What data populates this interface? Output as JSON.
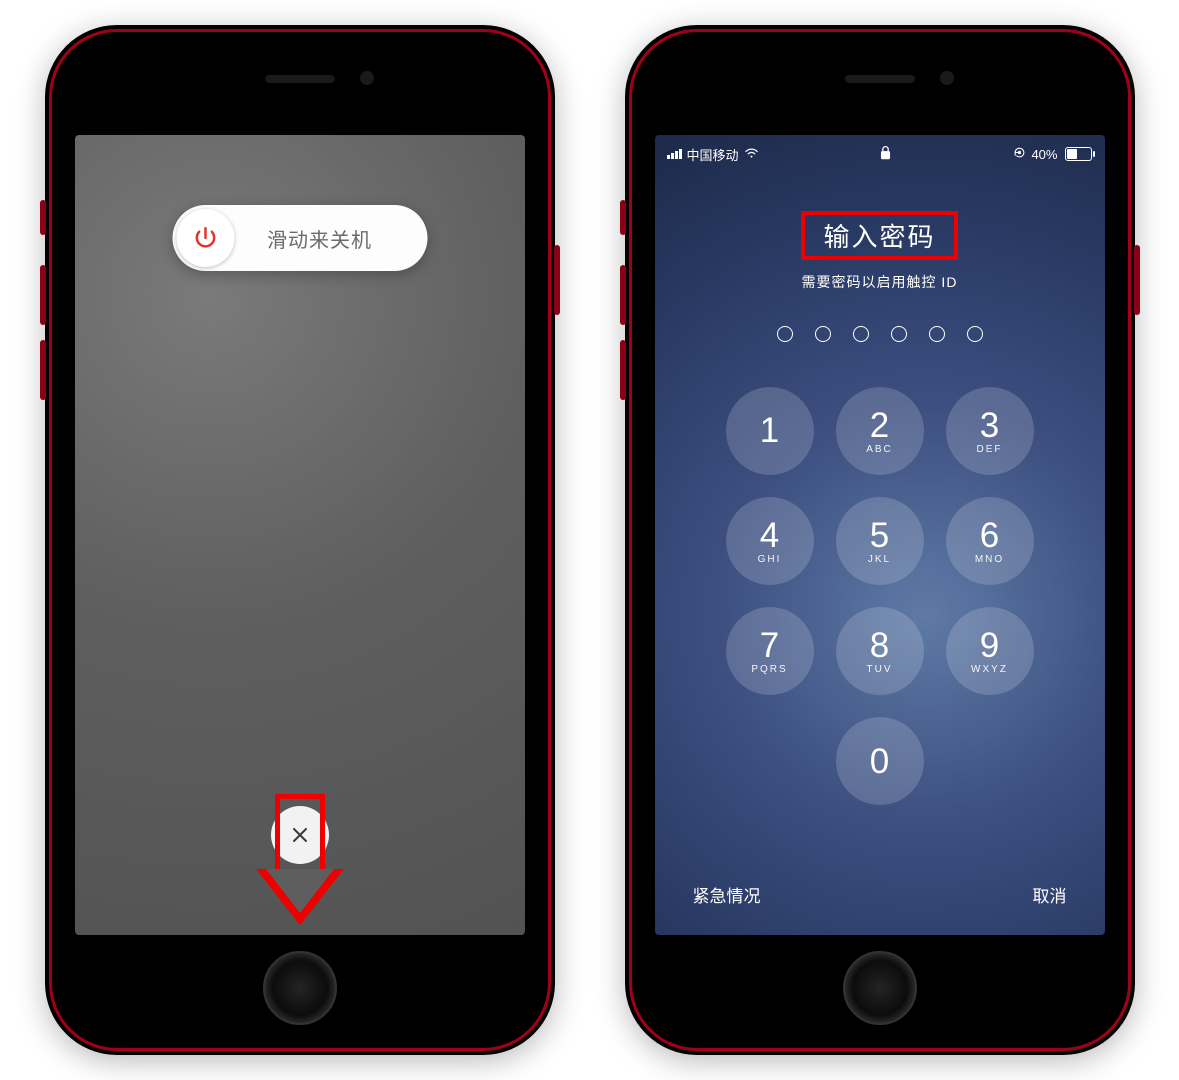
{
  "phones": {
    "left": {
      "power_off_slider_label": "滑动来关机",
      "cancel_label": "取消"
    },
    "right": {
      "status": {
        "carrier": "中国移动",
        "battery_pct": "40%"
      },
      "title": "输入密码",
      "subtitle": "需要密码以启用触控 ID",
      "passcode_length": 6,
      "keypad": [
        {
          "num": "1",
          "let": ""
        },
        {
          "num": "2",
          "let": "ABC"
        },
        {
          "num": "3",
          "let": "DEF"
        },
        {
          "num": "4",
          "let": "GHI"
        },
        {
          "num": "5",
          "let": "JKL"
        },
        {
          "num": "6",
          "let": "MNO"
        },
        {
          "num": "7",
          "let": "PQRS"
        },
        {
          "num": "8",
          "let": "TUV"
        },
        {
          "num": "9",
          "let": "WXYZ"
        },
        {
          "num": "0",
          "let": ""
        }
      ],
      "emergency_label": "紧急情况",
      "cancel_label": "取消"
    }
  }
}
